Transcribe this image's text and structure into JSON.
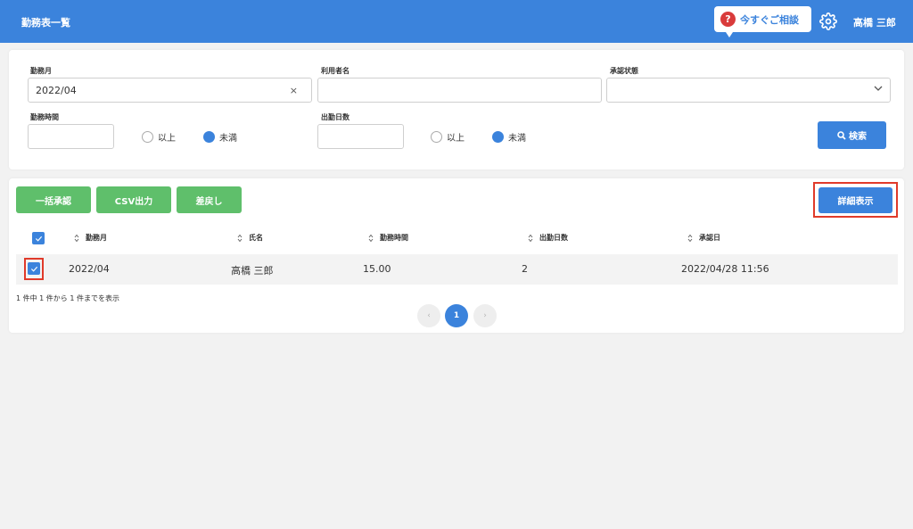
{
  "header": {
    "title": "勤務表一覧",
    "help_icon": "?",
    "help_label": "今すぐご相談",
    "user_name": "高橋 三郎"
  },
  "filters": {
    "month_label": "勤務月",
    "month_value": "2022/04",
    "clear_icon": "×",
    "user_label": "利用者名",
    "user_value": "",
    "approval_label": "承認状態",
    "approval_value": "",
    "hours_label": "勤務時間",
    "hours_value": "",
    "hours_radio_above": "以上",
    "hours_radio_below": "未満",
    "days_label": "出勤日数",
    "days_value": "",
    "days_radio_above": "以上",
    "days_radio_below": "未満",
    "search_label": "検索"
  },
  "toolbar": {
    "bulk_approve": "一括承認",
    "csv_export": "CSV出力",
    "send_back": "差戻し",
    "detail": "詳細表示"
  },
  "table": {
    "columns": [
      "勤務月",
      "氏名",
      "勤務時間",
      "出勤日数",
      "承認日"
    ],
    "rows": [
      {
        "month": "2022/04",
        "name": "高橋 三郎",
        "hours": "15.00",
        "days": "2",
        "approved": "2022/04/28 11:56"
      }
    ]
  },
  "pagination": {
    "summary": "1 件中 1 件から 1 件までを表示",
    "prev": "‹",
    "current": "1",
    "next": "›"
  },
  "colors": {
    "primary": "#3b83dc",
    "success": "#5fbf6b",
    "highlight": "#e03a2a",
    "help_icon": "#d93b3b"
  }
}
